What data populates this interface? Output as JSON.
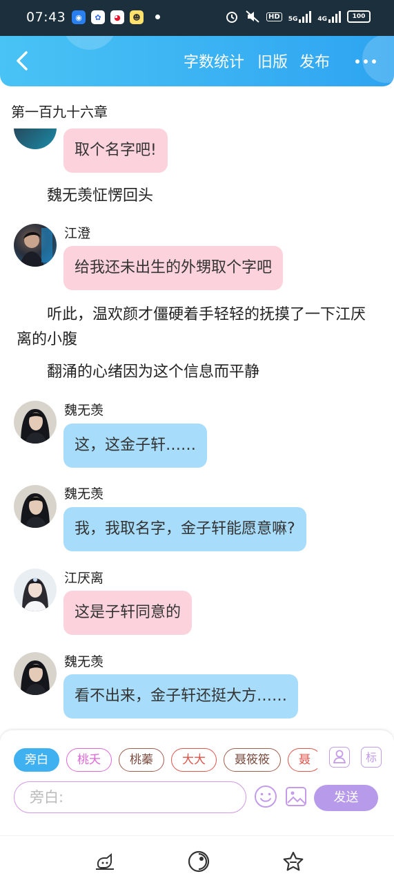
{
  "status_bar": {
    "time": "07:43",
    "network_5g": "5G",
    "network_4g": "4G",
    "hd": "HD",
    "battery": "100"
  },
  "header": {
    "word_count": "字数统计",
    "old_version": "旧版",
    "publish": "发布",
    "colors": {
      "start": "#49c3f5",
      "end": "#2ea4f1"
    }
  },
  "chapter_title": "第一百九十六章",
  "messages": [
    {
      "type": "bubble",
      "speaker": "",
      "text": "取个名字吧!",
      "color": "#fcd3dd"
    },
    {
      "type": "narration",
      "text": "魏无羡怔愣回头"
    },
    {
      "type": "bubble",
      "speaker": "江澄",
      "text": "给我还未出生的外甥取个字吧",
      "color": "#fcd3dd"
    },
    {
      "type": "narration",
      "text": "听此，温欢颜才僵硬着手轻轻的抚摸了一下江厌离的小腹"
    },
    {
      "type": "narration",
      "text": "翻涌的心绪因为这个信息而平静"
    },
    {
      "type": "bubble",
      "speaker": "魏无羡",
      "text": "这，这金子轩……",
      "color": "#a7dcfa"
    },
    {
      "type": "bubble",
      "speaker": "魏无羡",
      "text": "我，我取名字，金子轩能愿意嘛?",
      "color": "#a7dcfa"
    },
    {
      "type": "bubble",
      "speaker": "江厌离",
      "text": "这是子轩同意的",
      "color": "#fcd3dd"
    },
    {
      "type": "bubble",
      "speaker": "魏无羡",
      "text": "看不出来，金子轩还挺大方……",
      "color": "#a7dcfa"
    }
  ],
  "editor": {
    "roles": [
      "旁白",
      "桃夭",
      "桃蓁",
      "大大",
      "聂筱筱",
      "聂"
    ],
    "selected_role": "旁白",
    "input_placeholder": "旁白:",
    "mark_label": "标",
    "send_label": "发送"
  },
  "nav": {
    "icons": [
      "writing-icon",
      "discover-icon",
      "favorites-icon"
    ]
  }
}
